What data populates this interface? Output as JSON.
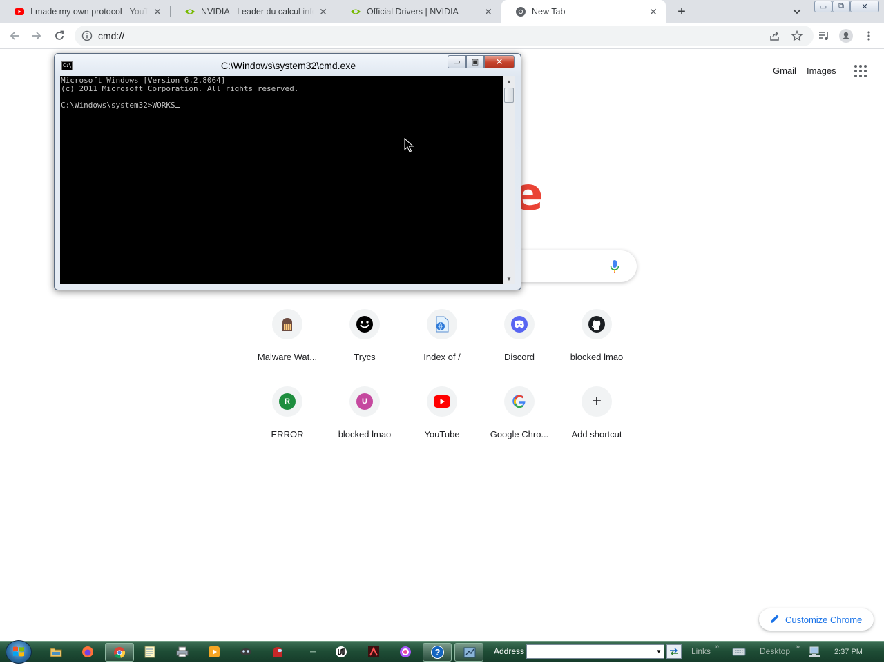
{
  "browser": {
    "tabs": [
      {
        "title": "I made my own protocol - YouTube",
        "icon": "youtube-icon"
      },
      {
        "title": "NVIDIA - Leader du calcul informatique",
        "icon": "nvidia-icon"
      },
      {
        "title": "Official Drivers | NVIDIA",
        "icon": "nvidia-icon"
      },
      {
        "title": "New Tab",
        "icon": "chrome-icon"
      }
    ],
    "new_tab_symbol": "+",
    "close_symbol": "✕",
    "window_controls": {
      "minimize": "▭",
      "maximize": "⧉",
      "close": "✕"
    },
    "address": "cmd://"
  },
  "ntp": {
    "gmail": "Gmail",
    "images": "Images",
    "logo_fragment": "e",
    "shortcuts": [
      {
        "title": "Malware Wat...",
        "icon": "malware-icon"
      },
      {
        "title": "Trycs",
        "icon": "smiley-icon"
      },
      {
        "title": "Index of /",
        "icon": "document-icon"
      },
      {
        "title": "Discord",
        "icon": "discord-icon"
      },
      {
        "title": "blocked lmao",
        "icon": "github-icon"
      },
      {
        "title": "ERROR",
        "icon": "letter-r-icon",
        "letter": "R",
        "color": "#1e8e3e"
      },
      {
        "title": "blocked lmao",
        "icon": "letter-u-icon",
        "letter": "U",
        "color": "#c5499f"
      },
      {
        "title": "YouTube",
        "icon": "youtube-icon"
      },
      {
        "title": "Google Chro...",
        "icon": "google-icon"
      },
      {
        "title": "Add shortcut",
        "icon": "plus-icon",
        "symbol": "+"
      }
    ],
    "customize_label": "Customize Chrome"
  },
  "cmd": {
    "title": "C:\\Windows\\system32\\cmd.exe",
    "icon_text": "C:\\",
    "lines": [
      "Microsoft Windows [Version 6.2.8064]",
      "(c) 2011 Microsoft Corporation. All rights reserved.",
      "",
      "C:\\Windows\\system32>WORKS"
    ],
    "buttons": {
      "minimize": "▭",
      "maximize": "▣",
      "close": "✕"
    },
    "scroll_up": "▲",
    "scroll_down": "▼"
  },
  "taskbar": {
    "address_label": "Address",
    "address_value": "",
    "address_dropdown": "▼",
    "links": "Links",
    "desktop": "Desktop",
    "chevron": "»",
    "help_symbol": "?",
    "clock": "2:37 PM"
  },
  "colors": {
    "youtube_red": "#ff0000",
    "nvidia_green": "#76b900",
    "discord_blurple": "#5865f2",
    "chrome_blue": "#1a73e8",
    "google_red": "#ea4335"
  }
}
